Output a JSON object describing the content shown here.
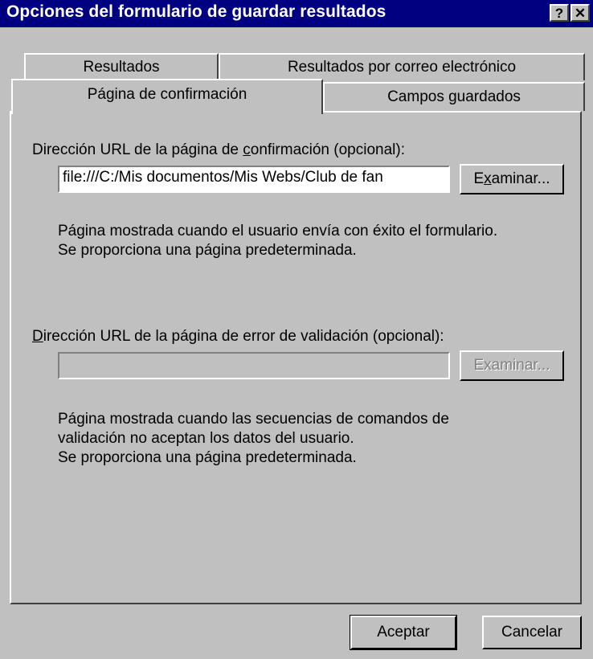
{
  "window": {
    "title": "Opciones del formulario de guardar resultados",
    "help_button": "?",
    "close_button": "✕"
  },
  "tabs": [
    {
      "label": "Resultados",
      "active": false
    },
    {
      "label": "Resultados por correo electrónico",
      "active": false
    },
    {
      "label": "Página de confirmación",
      "active": true
    },
    {
      "label": "Campos guardados",
      "active": false
    }
  ],
  "confirmation": {
    "label_before": "Dirección URL de la página de ",
    "label_mnemonic": "c",
    "label_after": "onfirmación (opcional):",
    "url_value": "file:///C:/Mis documentos/Mis Webs/Club de fan",
    "browse_before": "E",
    "browse_mnemonic": "x",
    "browse_after": "aminar...",
    "desc_line1": "Página mostrada cuando el usuario envía con éxito el formulario.",
    "desc_line2": "Se proporciona una página predeterminada."
  },
  "validation": {
    "label_mnemonic": "D",
    "label_after": "irección URL de la página de error de validación (opcional):",
    "url_value": "",
    "browse_label": "Examinar...",
    "desc_line1": "Página mostrada cuando las secuencias de comandos de",
    "desc_line2": "validación no aceptan los datos del usuario.",
    "desc_line3": "Se proporciona una página predeterminada."
  },
  "footer": {
    "ok_label": "Aceptar",
    "cancel_label": "Cancelar"
  }
}
